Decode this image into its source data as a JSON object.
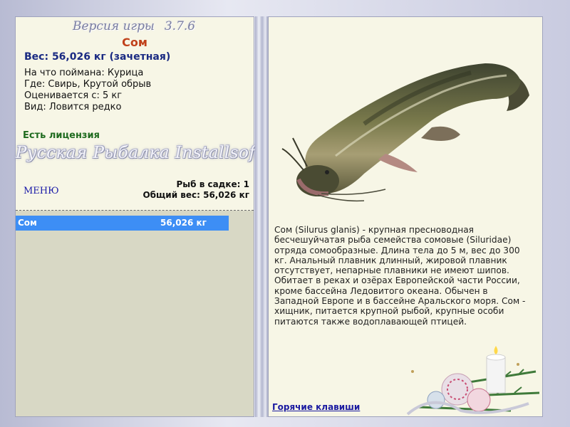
{
  "header": {
    "version_label": "Версия игры",
    "version_number": "3.7.6"
  },
  "fish": {
    "name": "Сом",
    "weight_line": "Вес: 56,026 кг (зачетная)",
    "bait_line": "На что поймана: Курица",
    "location_line": "Где: Свирь, Крутой обрыв",
    "valued_line": "Оценивается с: 5 кг",
    "kind_line": "Вид: Ловится редко"
  },
  "license": "Есть лицензия",
  "logo_text": "Русская Рыбалка Installsoft",
  "menu_label": "МЕНЮ",
  "cage": {
    "count_line": "Рыб в садке: 1",
    "total_line": "Общий вес: 56,026 кг",
    "items": [
      {
        "name": "Сом",
        "weight": "56,026 кг"
      }
    ]
  },
  "description": "Сом (Silurus glanis) - крупная пресноводная бесчешуйчатая рыба семейства сомовые (Siluridae) отряда сомообразные. Длина тела до 5 м, вес до 300 кг. Анальный плавник длинный, жировой плавник отсутствует, непарные плавники не имеют шипов. Обитает в реках и озёрах Европейской части России, кроме бассейна Ледовитого океана. Обычен в Западной Европе и в бассейне Аральского моря. Сом - хищник, питается крупной рыбой, крупные особи питаются также водоплавающей птицей.",
  "hotkeys_label": "Горячие клавиши",
  "colors": {
    "fish_name": "#c0411b",
    "weight": "#1a2a82",
    "license": "#1f6b1f",
    "selected_row": "#3d8ef5",
    "link": "#1a1aa0"
  }
}
